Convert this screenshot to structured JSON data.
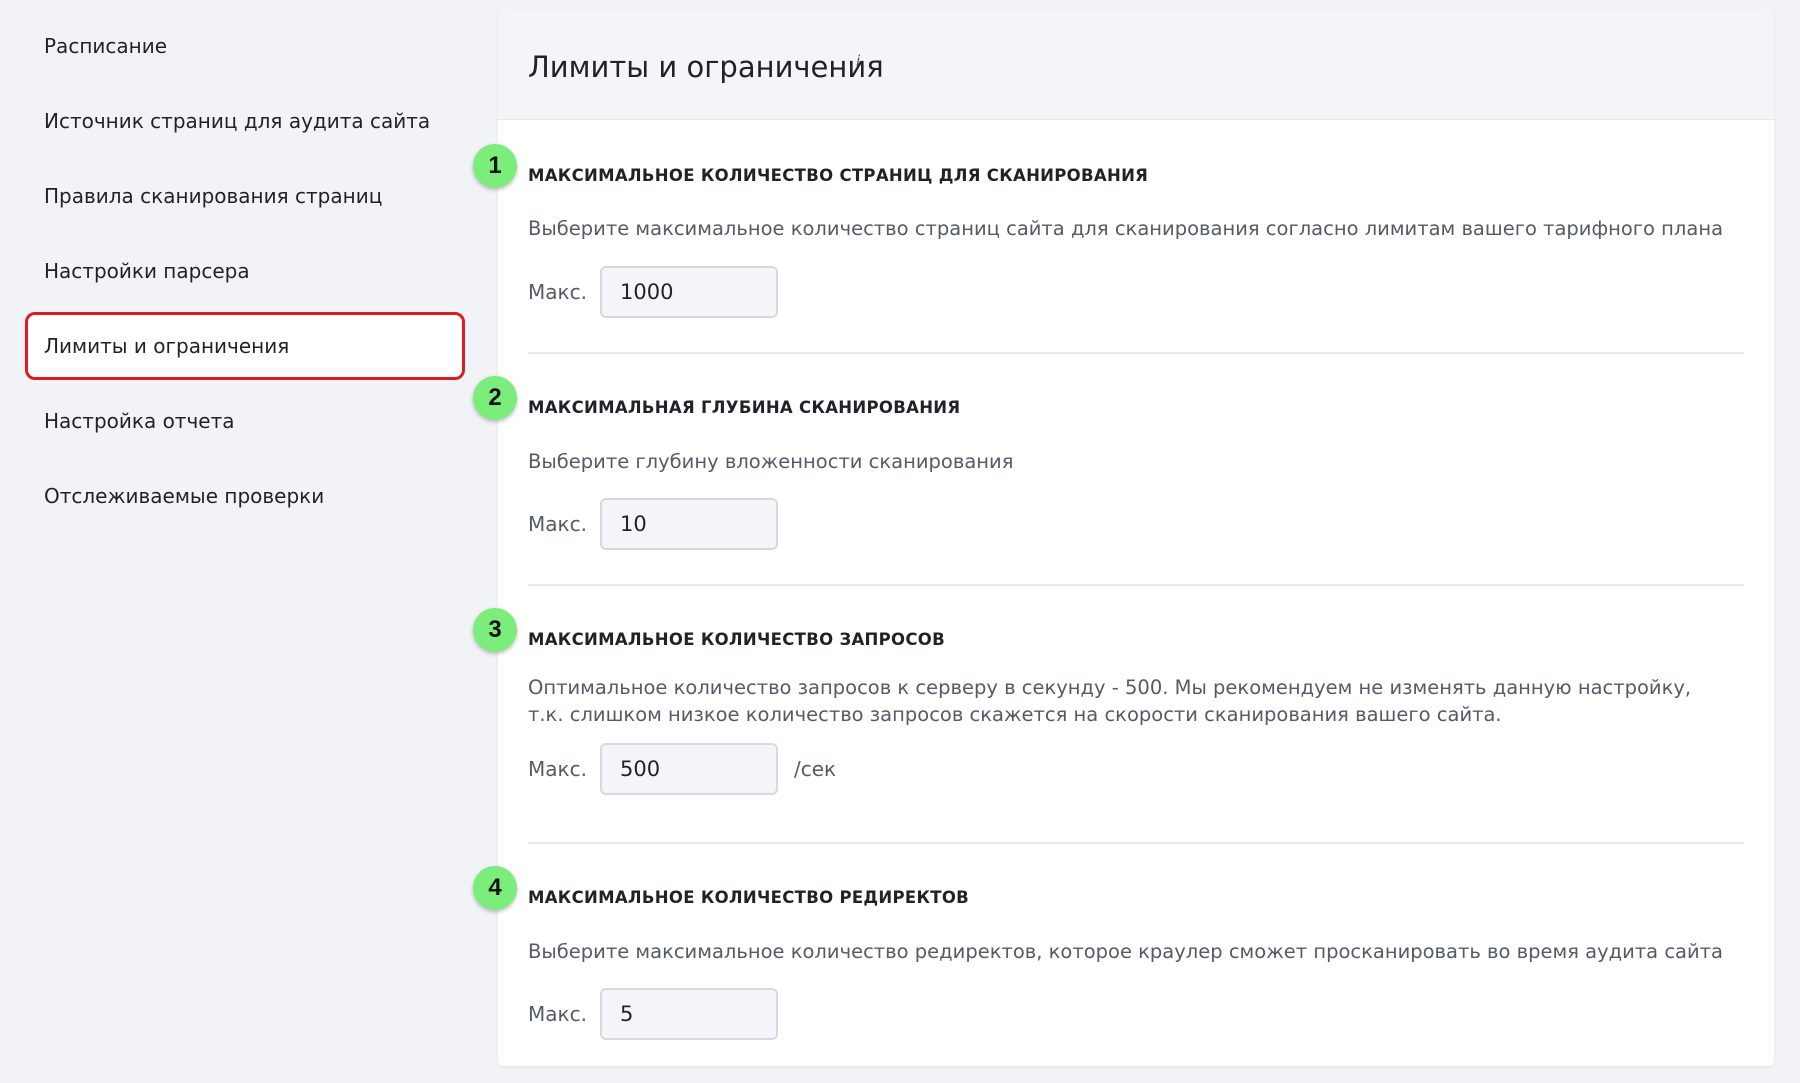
{
  "sidebar": {
    "items": [
      {
        "label": "Расписание"
      },
      {
        "label": "Источник страниц для аудита сайта"
      },
      {
        "label": "Правила сканирования страниц"
      },
      {
        "label": "Настройки парсера"
      },
      {
        "label": "Лимиты и ограничения",
        "active": true
      },
      {
        "label": "Настройка отчета"
      },
      {
        "label": "Отслеживаемые проверки"
      }
    ]
  },
  "panel": {
    "title": "Лимиты и ограничения",
    "info_icon": "i",
    "max_label": "Макс.",
    "sections": [
      {
        "badge": "1",
        "title": "МАКСИМАЛЬНОЕ КОЛИЧЕСТВО СТРАНИЦ ДЛЯ СКАНИРОВАНИЯ",
        "description": "Выберите максимальное количество страниц сайта для сканирования согласно лимитам вашего тарифного плана",
        "value": "1000"
      },
      {
        "badge": "2",
        "title": "МАКСИМАЛЬНАЯ ГЛУБИНА СКАНИРОВАНИЯ",
        "description": "Выберите глубину вложенности сканирования",
        "value": "10"
      },
      {
        "badge": "3",
        "title": "МАКСИМАЛЬНОЕ КОЛИЧЕСТВО ЗАПРОСОВ",
        "description": "Оптимальное количество запросов к серверу в секунду - 500. Мы рекомендуем не изменять данную настройку, т.к. слишком низкое количество запросов скажется на скорости сканирования вашего сайта.",
        "value": "500",
        "unit": "/сек"
      },
      {
        "badge": "4",
        "title": "МАКСИМАЛЬНОЕ КОЛИЧЕСТВО РЕДИРЕКТОВ",
        "description": "Выберите максимальное количество редиректов, которое краулер сможет просканировать во время аудита сайта",
        "value": "5"
      }
    ]
  },
  "colors": {
    "accent_border": "#e01b22",
    "badge_green": "#7bed7b",
    "background": "#f2f3f7"
  }
}
